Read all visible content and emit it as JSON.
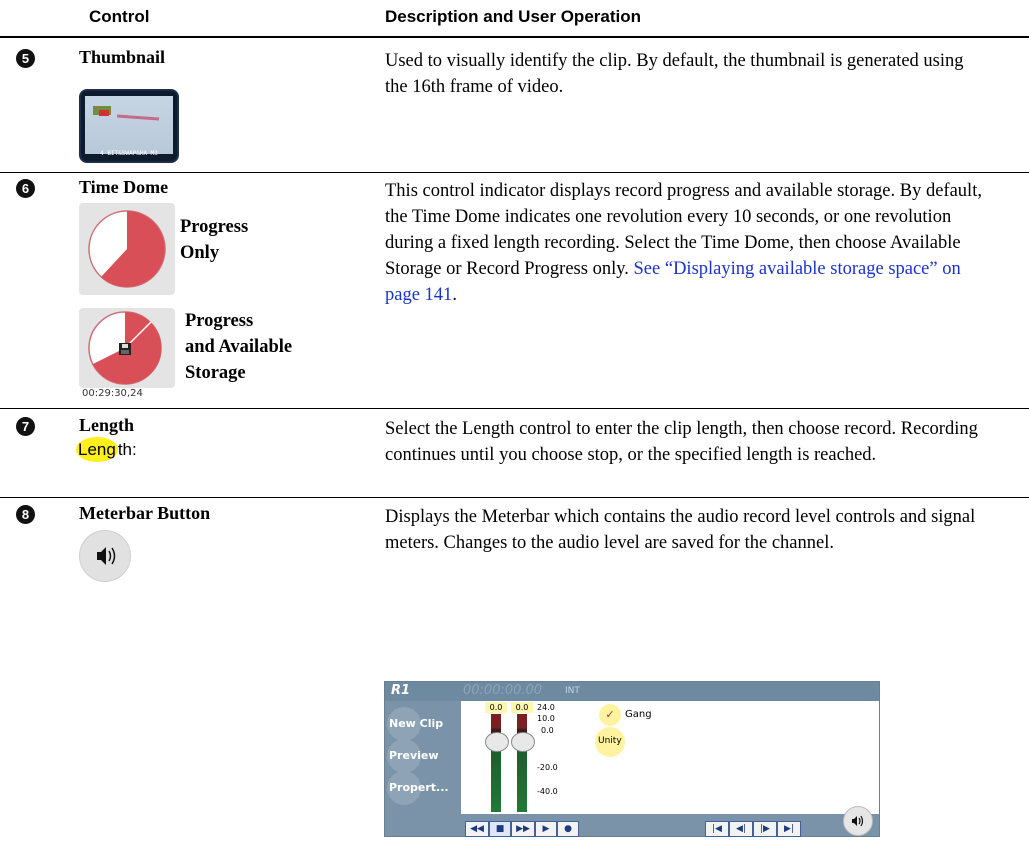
{
  "header": {
    "control": "Control",
    "description": "Description and User Operation"
  },
  "rows": [
    {
      "number": "5",
      "title": "Thumbnail",
      "description": "Used to visually identify the clip. By default, the thumbnail is generated using the 16th frame of video.",
      "thumb_caption": "4 BIT&SWAP&HA M3"
    },
    {
      "number": "6",
      "title": "Time Dome",
      "label_progress": [
        "Progress",
        "Only"
      ],
      "label_storage": [
        "Progress",
        "and Available",
        "Storage"
      ],
      "timecode": "00:29:30,24",
      "description_plain": "This control indicator displays record progress and available storage. By default, the Time Dome indicates one revolution every 10 seconds, or one revolution during a fixed length recording. Select the Time Dome, then choose Available Storage or Record Progress only.",
      "link_text": "See “Displaying available storage space” on page 141",
      "link_tail": "."
    },
    {
      "number": "7",
      "title": "Length",
      "length_hl": "Leng",
      "length_rest": "th:",
      "description": "Select the Length control to enter the clip length, then choose record. Recording continues until you choose stop, or the specified length is reached."
    },
    {
      "number": "8",
      "title": "Meterbar Button",
      "description": "Displays the Meterbar which contains the audio record level controls and signal meters. Changes to the audio level are saved for the channel."
    }
  ],
  "meterbar": {
    "channel": "R1",
    "timecode": "00:00:00.00",
    "source": "INT",
    "side_buttons": [
      "New Clip",
      "Preview",
      "Propert..."
    ],
    "meter_values": [
      "0.0",
      "0.0"
    ],
    "scale": [
      "24.0",
      "10.0",
      "0.0",
      "-20.0",
      "-40.0"
    ],
    "gang_label": "Gang",
    "unity_label": "Unity"
  },
  "colors": {
    "dome_fill": "#d94f57",
    "dome_bg": "#e4e4e4",
    "highlight": "#ffef1a",
    "link": "#1a33cc",
    "panel": "#7a93a8"
  }
}
